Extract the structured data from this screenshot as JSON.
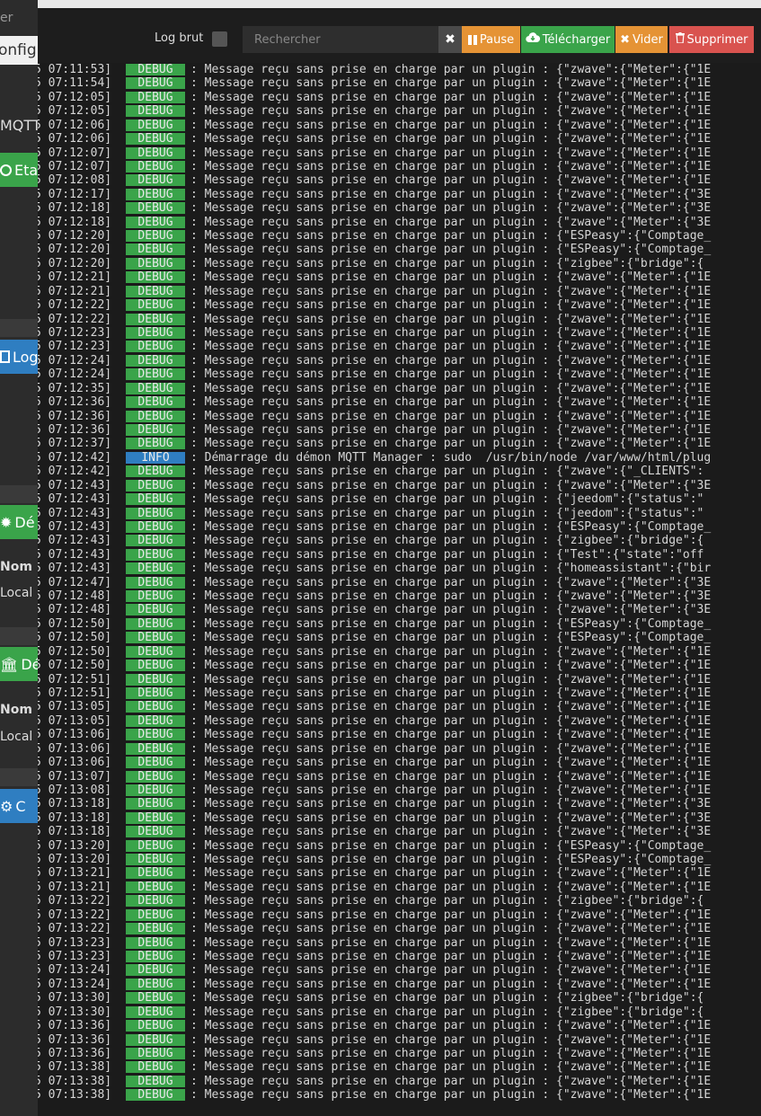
{
  "background": {
    "top_text": "er",
    "config_tab": "onfigu",
    "mqtt_label": "MQTT",
    "etat_button": "Eta",
    "log_button": "Log",
    "demon_button": "Dé",
    "nom_label_1": "Nom",
    "local_label_1": "Local",
    "dependances_button": "Dé",
    "nom_label_2": "Nom",
    "local_label_2": "Local",
    "config_button": "C"
  },
  "toolbar": {
    "log_brut_label": "Log brut",
    "search_placeholder": "Rechercher",
    "clear_symbol": "✖",
    "pause_label": "Pause",
    "download_label": "Télécharger",
    "vider_label": "Vider",
    "supprimer_label": "Supprimer"
  },
  "colors": {
    "debug": "#3aa44a",
    "info": "#2f7ec1",
    "pause": "#e59335",
    "download": "#3aa44a",
    "delete": "#d9534f"
  },
  "log": {
    "default_message": "Message reçu sans prise en charge par un plugin",
    "rows": [
      {
        "t": "07:11:53",
        "l": "DEBUG",
        "p": "{\"zwave\":{\"Meter\":{\"1E"
      },
      {
        "t": "07:11:54",
        "l": "DEBUG",
        "p": "{\"zwave\":{\"Meter\":{\"1E"
      },
      {
        "t": "07:12:05",
        "l": "DEBUG",
        "p": "{\"zwave\":{\"Meter\":{\"1E"
      },
      {
        "t": "07:12:05",
        "l": "DEBUG",
        "p": "{\"zwave\":{\"Meter\":{\"1E"
      },
      {
        "t": "07:12:06",
        "l": "DEBUG",
        "p": "{\"zwave\":{\"Meter\":{\"1E"
      },
      {
        "t": "07:12:06",
        "l": "DEBUG",
        "p": "{\"zwave\":{\"Meter\":{\"1E"
      },
      {
        "t": "07:12:07",
        "l": "DEBUG",
        "p": "{\"zwave\":{\"Meter\":{\"1E"
      },
      {
        "t": "07:12:07",
        "l": "DEBUG",
        "p": "{\"zwave\":{\"Meter\":{\"1E"
      },
      {
        "t": "07:12:08",
        "l": "DEBUG",
        "p": "{\"zwave\":{\"Meter\":{\"1E"
      },
      {
        "t": "07:12:17",
        "l": "DEBUG",
        "p": "{\"zwave\":{\"Meter\":{\"3E"
      },
      {
        "t": "07:12:18",
        "l": "DEBUG",
        "p": "{\"zwave\":{\"Meter\":{\"3E"
      },
      {
        "t": "07:12:18",
        "l": "DEBUG",
        "p": "{\"zwave\":{\"Meter\":{\"3E"
      },
      {
        "t": "07:12:20",
        "l": "DEBUG",
        "p": "{\"ESPeasy\":{\"Comptage_"
      },
      {
        "t": "07:12:20",
        "l": "DEBUG",
        "p": "{\"ESPeasy\":{\"Comptage_"
      },
      {
        "t": "07:12:20",
        "l": "DEBUG",
        "p": "{\"zigbee\":{\"bridge\":{"
      },
      {
        "t": "07:12:21",
        "l": "DEBUG",
        "p": "{\"zwave\":{\"Meter\":{\"1E"
      },
      {
        "t": "07:12:21",
        "l": "DEBUG",
        "p": "{\"zwave\":{\"Meter\":{\"1E"
      },
      {
        "t": "07:12:22",
        "l": "DEBUG",
        "p": "{\"zwave\":{\"Meter\":{\"1E"
      },
      {
        "t": "07:12:22",
        "l": "DEBUG",
        "p": "{\"zwave\":{\"Meter\":{\"1E"
      },
      {
        "t": "07:12:23",
        "l": "DEBUG",
        "p": "{\"zwave\":{\"Meter\":{\"1E"
      },
      {
        "t": "07:12:23",
        "l": "DEBUG",
        "p": "{\"zwave\":{\"Meter\":{\"1E"
      },
      {
        "t": "07:12:24",
        "l": "DEBUG",
        "p": "{\"zwave\":{\"Meter\":{\"1E"
      },
      {
        "t": "07:12:24",
        "l": "DEBUG",
        "p": "{\"zwave\":{\"Meter\":{\"1E"
      },
      {
        "t": "07:12:35",
        "l": "DEBUG",
        "p": "{\"zwave\":{\"Meter\":{\"1E"
      },
      {
        "t": "07:12:36",
        "l": "DEBUG",
        "p": "{\"zwave\":{\"Meter\":{\"1E"
      },
      {
        "t": "07:12:36",
        "l": "DEBUG",
        "p": "{\"zwave\":{\"Meter\":{\"1E"
      },
      {
        "t": "07:12:36",
        "l": "DEBUG",
        "p": "{\"zwave\":{\"Meter\":{\"1E"
      },
      {
        "t": "07:12:37",
        "l": "DEBUG",
        "p": "{\"zwave\":{\"Meter\":{\"1E"
      },
      {
        "t": "07:12:42",
        "l": "INFO",
        "m": "Démarrage du démon MQTT Manager : sudo  /usr/bin/node /var/www/html/plug"
      },
      {
        "t": "07:12:42",
        "l": "DEBUG",
        "p": "{\"zwave\":{\"_CLIENTS\":"
      },
      {
        "t": "07:12:43",
        "l": "DEBUG",
        "p": "{\"zwave\":{\"Meter\":{\"3E"
      },
      {
        "t": "07:12:43",
        "l": "DEBUG",
        "p": "{\"jeedom\":{\"status\":\""
      },
      {
        "t": "07:12:43",
        "l": "DEBUG",
        "p": "{\"jeedom\":{\"status\":\""
      },
      {
        "t": "07:12:43",
        "l": "DEBUG",
        "p": "{\"ESPeasy\":{\"Comptage_"
      },
      {
        "t": "07:12:43",
        "l": "DEBUG",
        "p": "{\"zigbee\":{\"bridge\":{"
      },
      {
        "t": "07:12:43",
        "l": "DEBUG",
        "p": "{\"Test\":{\"state\":\"off"
      },
      {
        "t": "07:12:43",
        "l": "DEBUG",
        "p": "{\"homeassistant\":{\"bir"
      },
      {
        "t": "07:12:47",
        "l": "DEBUG",
        "p": "{\"zwave\":{\"Meter\":{\"3E"
      },
      {
        "t": "07:12:48",
        "l": "DEBUG",
        "p": "{\"zwave\":{\"Meter\":{\"3E"
      },
      {
        "t": "07:12:48",
        "l": "DEBUG",
        "p": "{\"zwave\":{\"Meter\":{\"3E"
      },
      {
        "t": "07:12:50",
        "l": "DEBUG",
        "p": "{\"ESPeasy\":{\"Comptage_"
      },
      {
        "t": "07:12:50",
        "l": "DEBUG",
        "p": "{\"ESPeasy\":{\"Comptage_"
      },
      {
        "t": "07:12:50",
        "l": "DEBUG",
        "p": "{\"zwave\":{\"Meter\":{\"1E"
      },
      {
        "t": "07:12:50",
        "l": "DEBUG",
        "p": "{\"zwave\":{\"Meter\":{\"1E"
      },
      {
        "t": "07:12:51",
        "l": "DEBUG",
        "p": "{\"zwave\":{\"Meter\":{\"1E"
      },
      {
        "t": "07:12:51",
        "l": "DEBUG",
        "p": "{\"zwave\":{\"Meter\":{\"1E"
      },
      {
        "t": "07:13:05",
        "l": "DEBUG",
        "p": "{\"zwave\":{\"Meter\":{\"1E"
      },
      {
        "t": "07:13:05",
        "l": "DEBUG",
        "p": "{\"zwave\":{\"Meter\":{\"1E"
      },
      {
        "t": "07:13:06",
        "l": "DEBUG",
        "p": "{\"zwave\":{\"Meter\":{\"1E"
      },
      {
        "t": "07:13:06",
        "l": "DEBUG",
        "p": "{\"zwave\":{\"Meter\":{\"1E"
      },
      {
        "t": "07:13:06",
        "l": "DEBUG",
        "p": "{\"zwave\":{\"Meter\":{\"1E"
      },
      {
        "t": "07:13:07",
        "l": "DEBUG",
        "p": "{\"zwave\":{\"Meter\":{\"1E"
      },
      {
        "t": "07:13:08",
        "l": "DEBUG",
        "p": "{\"zwave\":{\"Meter\":{\"1E"
      },
      {
        "t": "07:13:18",
        "l": "DEBUG",
        "p": "{\"zwave\":{\"Meter\":{\"3E"
      },
      {
        "t": "07:13:18",
        "l": "DEBUG",
        "p": "{\"zwave\":{\"Meter\":{\"3E"
      },
      {
        "t": "07:13:18",
        "l": "DEBUG",
        "p": "{\"zwave\":{\"Meter\":{\"3E"
      },
      {
        "t": "07:13:20",
        "l": "DEBUG",
        "p": "{\"ESPeasy\":{\"Comptage_"
      },
      {
        "t": "07:13:20",
        "l": "DEBUG",
        "p": "{\"ESPeasy\":{\"Comptage_"
      },
      {
        "t": "07:13:21",
        "l": "DEBUG",
        "p": "{\"zwave\":{\"Meter\":{\"1E"
      },
      {
        "t": "07:13:21",
        "l": "DEBUG",
        "p": "{\"zwave\":{\"Meter\":{\"1E"
      },
      {
        "t": "07:13:22",
        "l": "DEBUG",
        "p": "{\"zigbee\":{\"bridge\":{"
      },
      {
        "t": "07:13:22",
        "l": "DEBUG",
        "p": "{\"zwave\":{\"Meter\":{\"1E"
      },
      {
        "t": "07:13:22",
        "l": "DEBUG",
        "p": "{\"zwave\":{\"Meter\":{\"1E"
      },
      {
        "t": "07:13:23",
        "l": "DEBUG",
        "p": "{\"zwave\":{\"Meter\":{\"1E"
      },
      {
        "t": "07:13:23",
        "l": "DEBUG",
        "p": "{\"zwave\":{\"Meter\":{\"1E"
      },
      {
        "t": "07:13:24",
        "l": "DEBUG",
        "p": "{\"zwave\":{\"Meter\":{\"1E"
      },
      {
        "t": "07:13:24",
        "l": "DEBUG",
        "p": "{\"zwave\":{\"Meter\":{\"1E"
      },
      {
        "t": "07:13:30",
        "l": "DEBUG",
        "p": "{\"zigbee\":{\"bridge\":{"
      },
      {
        "t": "07:13:30",
        "l": "DEBUG",
        "p": "{\"zigbee\":{\"bridge\":{"
      },
      {
        "t": "07:13:36",
        "l": "DEBUG",
        "p": "{\"zwave\":{\"Meter\":{\"1E"
      },
      {
        "t": "07:13:36",
        "l": "DEBUG",
        "p": "{\"zwave\":{\"Meter\":{\"1E"
      },
      {
        "t": "07:13:36",
        "l": "DEBUG",
        "p": "{\"zwave\":{\"Meter\":{\"1E"
      },
      {
        "t": "07:13:38",
        "l": "DEBUG",
        "p": "{\"zwave\":{\"Meter\":{\"1E"
      },
      {
        "t": "07:13:38",
        "l": "DEBUG",
        "p": "{\"zwave\":{\"Meter\":{\"1E"
      },
      {
        "t": "07:13:38",
        "l": "DEBUG",
        "p": "{\"zwave\":{\"Meter\":{\"1E"
      }
    ]
  }
}
